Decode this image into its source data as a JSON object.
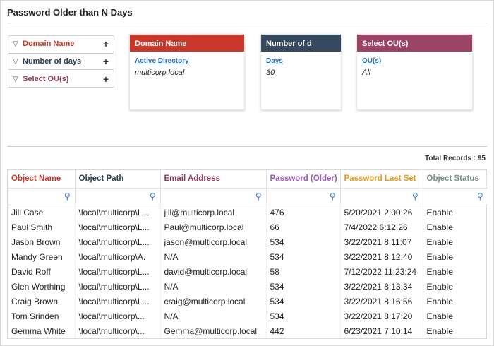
{
  "report": {
    "title": "Password Older than N Days",
    "total_label": "Total Records : 95"
  },
  "filters": [
    {
      "label": "Domain Name",
      "color": "#c0392b"
    },
    {
      "label": "Number of days",
      "color": "#2c3e50"
    },
    {
      "label": "Select OU(s)",
      "color": "#8e3a5e"
    }
  ],
  "cards": [
    {
      "header": "Domain Name",
      "color": "#c9382a",
      "key": "Active Directory",
      "value": "multicorp.local"
    },
    {
      "header": "Number of d",
      "color": "#34495e",
      "key": "Days",
      "value": "30"
    },
    {
      "header": "Select OU(s)",
      "color": "#9b4466",
      "key": "OU(s)",
      "value": "All"
    }
  ],
  "table": {
    "columns": [
      {
        "label": "Object Name",
        "color": "#c0392b"
      },
      {
        "label": "Object Path",
        "color": "#2c3e50"
      },
      {
        "label": "Email Address",
        "color": "#8e3a5e"
      },
      {
        "label": "Password (Older)",
        "color": "#9b59b6"
      },
      {
        "label": "Password Last Set",
        "color": "#e89a1a"
      },
      {
        "label": "Object Status",
        "color": "#7f8c8d"
      }
    ],
    "rows": [
      [
        "Jill Case",
        "\\local\\multicorp\\L...",
        "jill@multicorp.local",
        "476",
        "5/20/2021 2:00:26",
        "Enable"
      ],
      [
        "Paul Smith",
        "\\local\\multicorp\\L...",
        "Paul@multicorp.local",
        "66",
        "7/4/2022 6:12:26",
        "Enable"
      ],
      [
        "Jason Brown",
        "\\local\\multicorp\\L...",
        "jason@multicorp.local",
        "534",
        "3/22/2021 8:11:07",
        "Enable"
      ],
      [
        "Mandy Green",
        "\\local\\multicorp\\A.",
        "N/A",
        "534",
        "3/22/2021 8:12:40",
        "Enable"
      ],
      [
        "David Roff",
        "\\local\\multicorp\\L...",
        "david@multicorp.local",
        "58",
        "7/12/2022 11:23:24",
        "Enable"
      ],
      [
        "Glen Worthing",
        "\\local\\multicorp\\L...",
        "N/A",
        "534",
        "3/22/2021 8:13:34",
        "Enable"
      ],
      [
        "Craig Brown",
        "\\local\\multicorp\\L...",
        "craig@multicorp.local",
        "534",
        "3/22/2021 8:16:56",
        "Enable"
      ],
      [
        "Tom Srinden",
        "\\local\\multicorp\\...",
        "N/A",
        "534",
        "3/22/2021 8:17:20",
        "Enable"
      ],
      [
        "Gemma White",
        "\\local\\multicorp\\...",
        "Gemma@multicorp.local",
        "442",
        "6/23/2021 7:10:14",
        "Enable"
      ]
    ]
  },
  "icons": {
    "filter": "funnel-icon",
    "add": "plus-icon",
    "search": "search-icon"
  }
}
